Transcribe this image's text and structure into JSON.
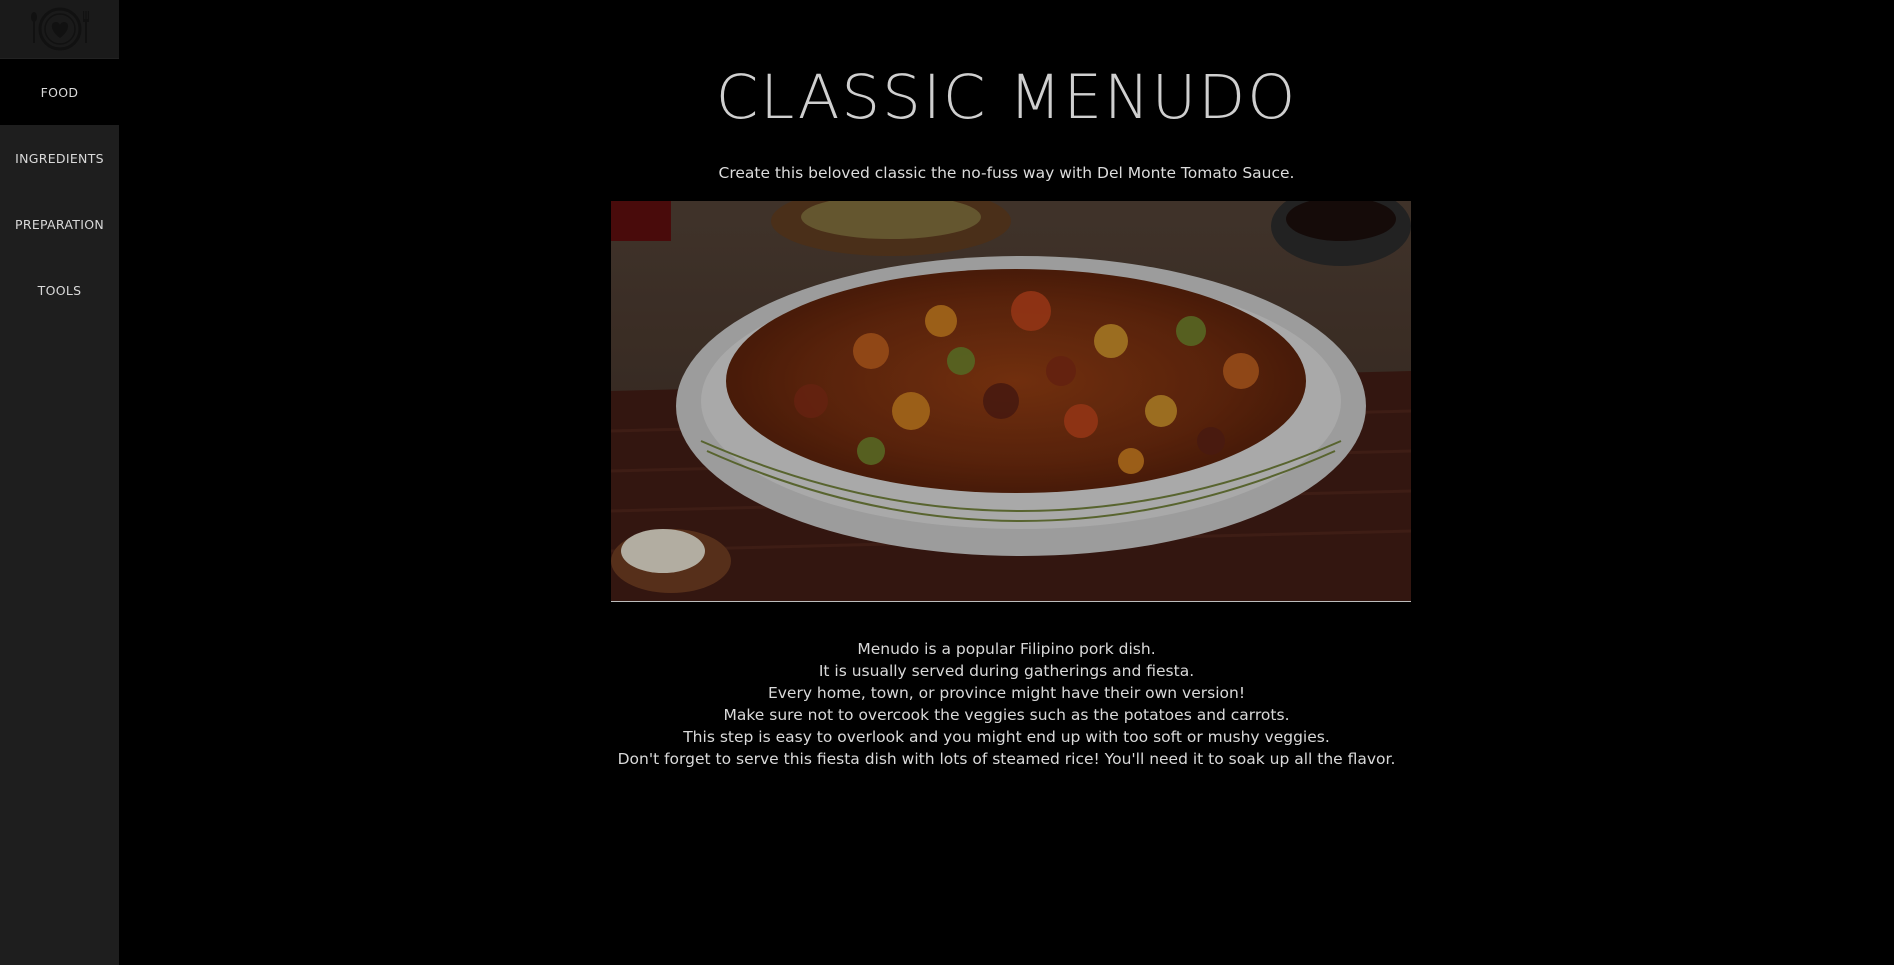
{
  "sidebar": {
    "logo_icon": "plate-heart-fork-spoon-icon",
    "items": [
      {
        "label": "FOOD",
        "active": true
      },
      {
        "label": "INGREDIENTS",
        "active": false
      },
      {
        "label": "PREPARATION",
        "active": false
      },
      {
        "label": "TOOLS",
        "active": false
      }
    ]
  },
  "main": {
    "title": "CLASSIC MENUDO",
    "subtitle": "Create this beloved classic the no-fuss way with Del Monte Tomato Sauce.",
    "hero_image_icon": "menudo-dish-photo",
    "description": [
      "Menudo is a popular Filipino pork dish.",
      "It is usually served during gatherings and fiesta.",
      "Every home, town, or province might have their own version!",
      "Make sure not to overcook the veggies such as the potatoes and carrots.",
      "This step is easy to overlook and you might end up with too soft or mushy veggies.",
      "Don't forget to serve this fiesta dish with lots of steamed rice! You'll need it to soak up all the flavor."
    ]
  },
  "colors": {
    "page_bg": "#000000",
    "sidebar_bg": "#1e1e1e",
    "active_nav_bg": "#000000",
    "title": "#cfcfcf",
    "text": "#d9d9d9"
  }
}
